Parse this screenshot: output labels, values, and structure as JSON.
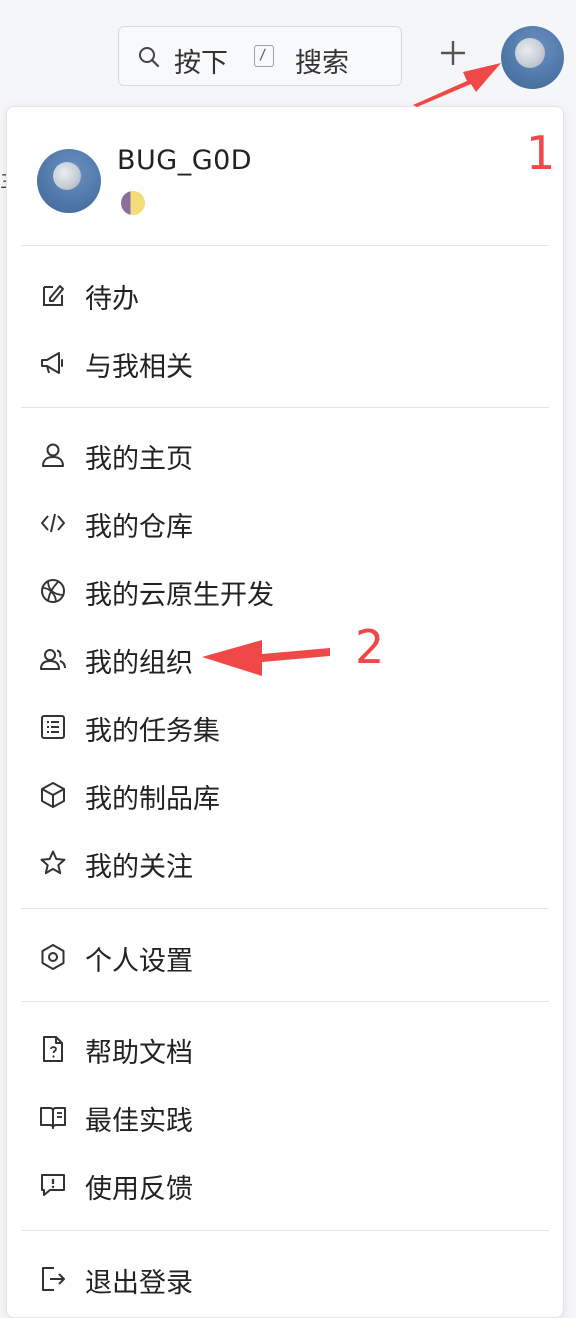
{
  "topbar": {
    "search_prefix": "按下",
    "search_suffix": "搜索",
    "search_key": "/",
    "plus_icon": "plus-icon",
    "avatar_icon": "moon-avatar"
  },
  "profile": {
    "username": "BUG_G0D",
    "status_icon": "moon-phase-emoji"
  },
  "menu": {
    "group1": [
      {
        "label": "待办",
        "icon": "todo-icon"
      },
      {
        "label": "与我相关",
        "icon": "megaphone-icon"
      }
    ],
    "group2": [
      {
        "label": "我的主页",
        "icon": "user-icon"
      },
      {
        "label": "我的仓库",
        "icon": "code-icon"
      },
      {
        "label": "我的云原生开发",
        "icon": "basketball-icon"
      },
      {
        "label": "我的组织",
        "icon": "users-icon"
      },
      {
        "label": "我的任务集",
        "icon": "list-icon"
      },
      {
        "label": "我的制品库",
        "icon": "box-icon"
      },
      {
        "label": "我的关注",
        "icon": "star-icon"
      }
    ],
    "group3": [
      {
        "label": "个人设置",
        "icon": "hexagon-settings-icon"
      }
    ],
    "group4": [
      {
        "label": "帮助文档",
        "icon": "doc-question-icon"
      },
      {
        "label": "最佳实践",
        "icon": "book-icon"
      },
      {
        "label": "使用反馈",
        "icon": "feedback-icon"
      }
    ],
    "group5": [
      {
        "label": "退出登录",
        "icon": "logout-icon"
      }
    ]
  },
  "annotations": {
    "marker1": "1",
    "marker2": "2"
  },
  "colors": {
    "accent_annotation": "#f04747",
    "avatar_blue": "#4e77a8"
  }
}
